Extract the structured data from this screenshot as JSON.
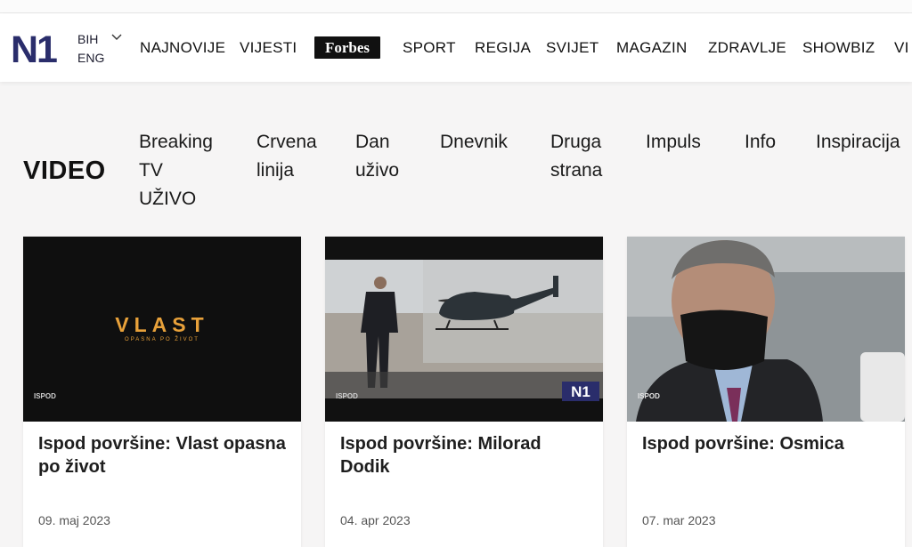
{
  "header": {
    "logo_text": "N1",
    "lang_primary": "BIH",
    "lang_secondary": "ENG",
    "nav": [
      "NAJNOVIJE",
      "VIJESTI",
      "Forbes",
      "SPORT",
      "REGIJA",
      "SVIJET",
      "MAGAZIN",
      "ZDRAVLJE",
      "SHOWBIZ",
      "VI"
    ]
  },
  "section": {
    "title": "VIDEO",
    "categories": [
      "Breaking\nTV\nUŽIVO",
      "Crvena\nlinija",
      "Dan\nuživo",
      "Dnevnik",
      "Druga\nstrana",
      "Impuls",
      "Info",
      "Inspiracija"
    ]
  },
  "cards": [
    {
      "title": "Ispod površine: Vlast opasna po život",
      "date": "09. maj 2023",
      "thumb_title": "VLAST",
      "thumb_sub": "OPASNA PO ŽIVOT",
      "badge": "ISPOD"
    },
    {
      "title": "Ispod površine: Milorad Dodik",
      "date": "04. apr 2023",
      "badge": "ISPOD",
      "logo": "N1"
    },
    {
      "title": "Ispod površine: Osmica",
      "date": "07. mar 2023",
      "badge": "ISPOD"
    }
  ],
  "colors": {
    "brand": "#2a2d6b",
    "accent_orange": "#e8a13a"
  }
}
